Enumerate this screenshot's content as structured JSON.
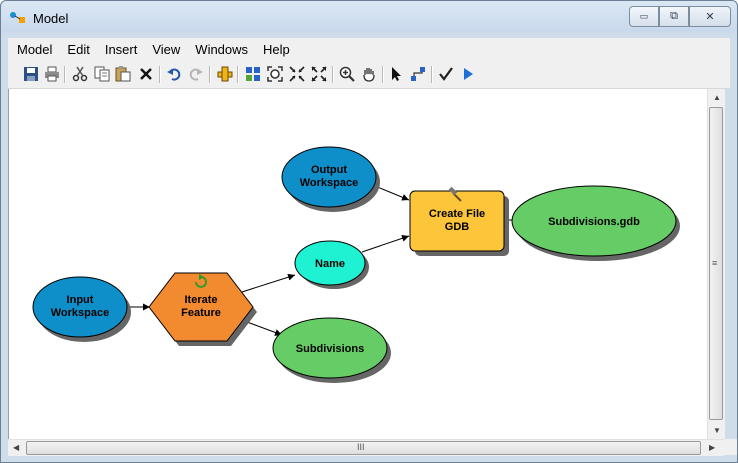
{
  "window": {
    "title": "Model"
  },
  "controls": {
    "minimize": "▭",
    "restore": "⧉",
    "close": "✕"
  },
  "menu": [
    "Model",
    "Edit",
    "Insert",
    "View",
    "Windows",
    "Help"
  ],
  "toolbar_icons": [
    "save-icon",
    "print-icon",
    "cut-icon",
    "copy-icon",
    "paste-icon",
    "delete-icon",
    "undo-icon",
    "redo-icon",
    "add-data-icon",
    "auto-layout-icon",
    "full-extent-icon",
    "fixed-zoom-in-icon",
    "fixed-zoom-out-icon",
    "zoom-in-icon",
    "pan-icon",
    "select-icon",
    "connect-icon",
    "validate-icon",
    "run-icon"
  ],
  "diagram": {
    "nodes": {
      "input_workspace": [
        "Input",
        "Workspace"
      ],
      "iterate_feature": [
        "Iterate",
        "Feature"
      ],
      "name": [
        "Name"
      ],
      "subdivisions": [
        "Subdivisions"
      ],
      "output_workspace": [
        "Output",
        "Workspace"
      ],
      "create_file_gdb": [
        "Create File",
        "GDB"
      ],
      "subdivisions_gdb": [
        "Subdivisions.gdb"
      ]
    },
    "colors": {
      "variable_blue": "#0f8fc9",
      "variable_cyan": "#1ef2d2",
      "output_green": "#66cc66",
      "iterator_orange": "#f28a30",
      "tool_yellow": "#fdc63a"
    }
  },
  "scrollbar_grip": "≡",
  "scrollbar_grip_h": "III"
}
